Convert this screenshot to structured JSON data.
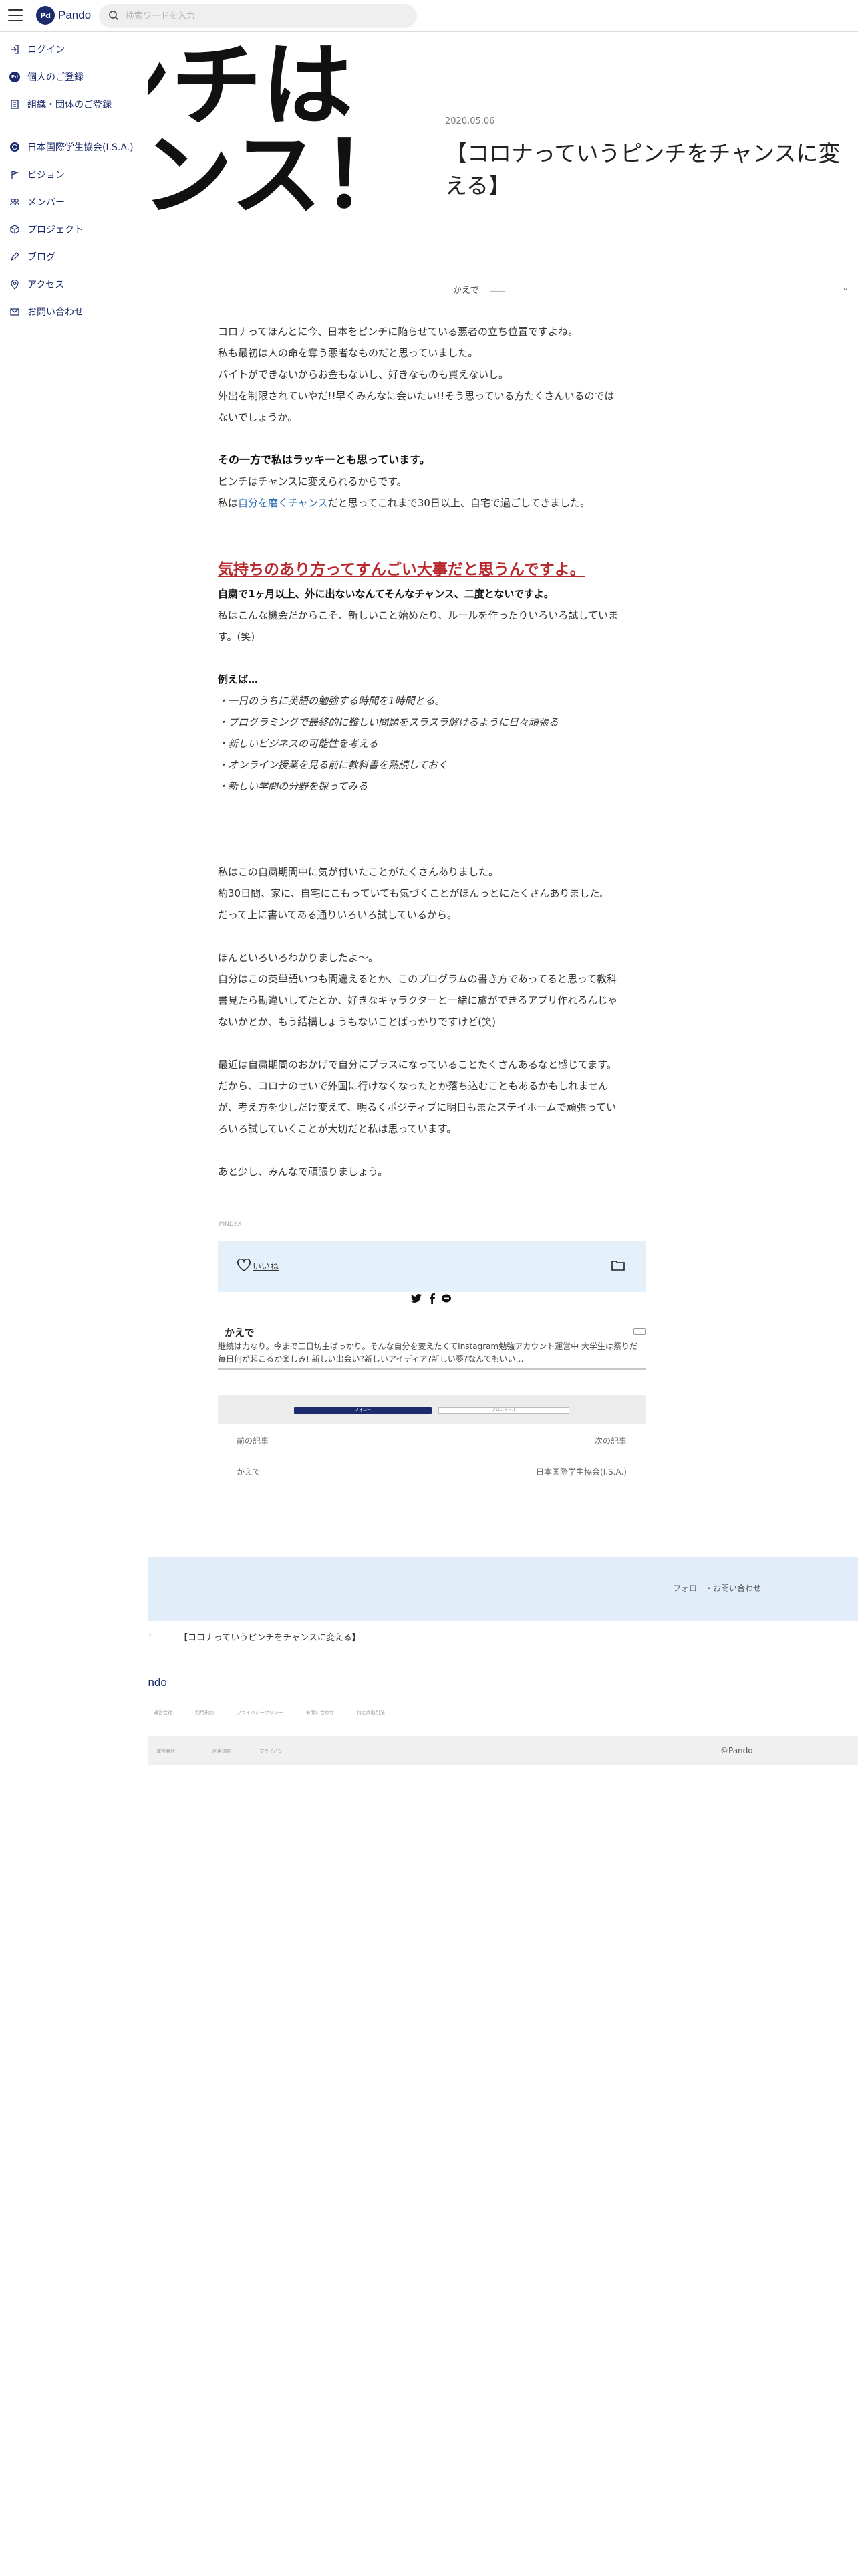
{
  "header": {
    "logo_mark": "Pd",
    "logo_text": "Pando",
    "search_placeholder": "検索ワードを入力"
  },
  "sidebar": {
    "items": [
      {
        "label": "ログイン",
        "icon": "login-icon"
      },
      {
        "label": "個人のご登録",
        "icon": "person-register-icon"
      },
      {
        "label": "組織・団体のご登録",
        "icon": "organization-register-icon"
      }
    ],
    "org_items": [
      {
        "label": "日本国際学生協会(I.S.A.)",
        "icon": "org-logo-icon"
      },
      {
        "label": "ビジョン",
        "icon": "vision-icon"
      },
      {
        "label": "メンバー",
        "icon": "members-icon"
      },
      {
        "label": "プロジェクト",
        "icon": "project-icon"
      },
      {
        "label": "ブログ",
        "icon": "blog-icon"
      },
      {
        "label": "アクセス",
        "icon": "location-icon"
      },
      {
        "label": "お問い合わせ",
        "icon": "mail-icon"
      }
    ]
  },
  "hero": {
    "line1": "ンチは",
    "line2": "ャンス！"
  },
  "post": {
    "date": "2020.05.06",
    "title": "【コロナっていうピンチをチャンスに変える】",
    "author": "かえで",
    "author_org": "____"
  },
  "article": {
    "p1": [
      "コロナってほんとに今、日本をピンチに陥らせている悪者の立ち位置ですよね。",
      "私も最初は人の命を奪う悪者なものだと思っていました。",
      "バイトができないからお金もないし、好きなものも買えないし。",
      "外出を制限されていやだ!!早くみんなに会いたい!!そう思っている方たくさんいるのでは",
      "ないでしょうか。"
    ],
    "h1": "その一方で私はラッキーとも思っています。",
    "p2a": "ピンチはチャンスに変えられるからです。",
    "p2b_pre": "私は",
    "p2b_link": "自分を磨くチャンス",
    "p2b_post": "だと思ってこれまで30日以上、自宅で過ごしてきました。",
    "red_heading": "気持ちのあり方ってすんごい大事だと思うんですよ。",
    "h2": "自粛で1ヶ月以上、外に出ないなんてそんなチャンス、二度とないですよ。",
    "p3": [
      "私はこんな機会だからこそ、新しいこと始めたり、ルールを作ったりいろいろ試していま",
      "す。(笑)"
    ],
    "h3": "例えば…",
    "examples": [
      "・一日のうちに英語の勉強する時間を1時間とる。",
      "・プログラミングで最終的に難しい問題をスラスラ解けるように日々頑張る",
      "・新しいビジネスの可能性を考える",
      "・オンライン授業を見る前に教科書を熟読しておく",
      "・新しい学問の分野を探ってみる"
    ],
    "p4": [
      "私はこの自粛期間中に気が付いたことがたくさんありました。",
      "約30日間、家に、自宅にこもっていても気づくことがほんっとにたくさんありました。",
      "だって上に書いてある通りいろいろ試しているから。"
    ],
    "p5": [
      "ほんといろいろわかりましたよ～。",
      "自分はこの英単語いつも間違えるとか、このプログラムの書き方であってると思って教科",
      "書見たら勘違いしてたとか、好きなキャラクターと一緒に旅ができるアプリ作れるんじゃ",
      "ないかとか、もう結構しょうもないことばっかりですけど(笑)"
    ],
    "p6": [
      "最近は自粛期間のおかげで自分にプラスになっていることたくさんあるなと感じてます。",
      "だから、コロナのせいで外国に行けなくなったとか落ち込むこともあるかもしれません",
      "が、考え方を少しだけ変えて、明るくポジティブに明日もまたステイホームで頑張ってい",
      "ろいろ試していくことが大切だと私は思っています。"
    ],
    "p7": "あと少し、みんなで頑張りましょう。"
  },
  "tags": "#INDEX",
  "like": {
    "label": "いいね"
  },
  "author_card": {
    "name": "かえで",
    "bio": "継続は力なり。今まで三日坊主ばっかり。そんな自分を変えたくてInstagram勉強アカウント運営中 大学生は祭りだ毎日何が起こるか楽しみ! 新しい出会い?新しいアイディア?新しい夢?なんでもいい…"
  },
  "follow_box": {
    "btn1": "フォロー",
    "btn2": "プロフィール"
  },
  "nav": {
    "prev": "前の記事",
    "next": "次の記事",
    "prev_author": "かえで",
    "next_author": "日本国際学生協会(I.S.A.)"
  },
  "footer": {
    "cta": "フォロー・お問い合わせ",
    "crumb_sep": "›",
    "crumb_current": "【コロナっていうピンチをチャンスに変える】",
    "logo": "ando",
    "links": [
      "運営会社",
      "利用規約",
      "プライバシーポリシー",
      "お問い合わせ",
      "特定商取引法"
    ],
    "bar_links": [
      "運営会社",
      "利用規約",
      "プライバシー"
    ],
    "copyright": "©Pando"
  }
}
